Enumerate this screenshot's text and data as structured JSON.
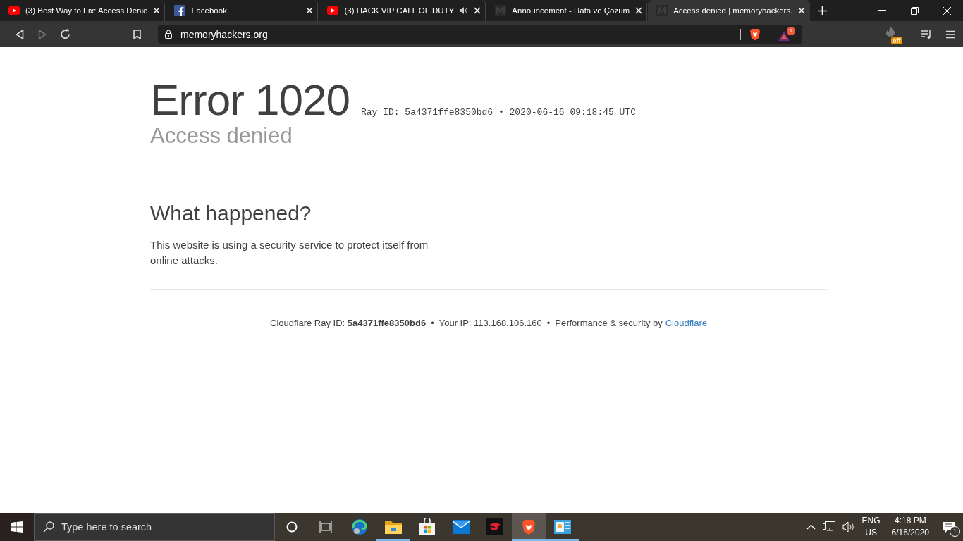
{
  "tabs": [
    {
      "title": "(3) Best Way to Fix: Access Denie",
      "kind": "youtube",
      "audio": false,
      "selected": false
    },
    {
      "title": "Facebook",
      "kind": "facebook",
      "audio": false,
      "selected": false
    },
    {
      "title": "(3) HACK VIP CALL OF DUTY",
      "kind": "youtube",
      "audio": true,
      "selected": false
    },
    {
      "title": "Announcement - Hata ve Çözüm",
      "kind": "m",
      "audio": false,
      "selected": false
    },
    {
      "title": "Access denied | memoryhackers.",
      "kind": "m",
      "audio": false,
      "selected": true
    }
  ],
  "toolbar": {
    "url": "memoryhackers.org",
    "rewards_badge": "1",
    "extension_badge": "off"
  },
  "page": {
    "title": "Error 1020",
    "ray_line": "Ray ID: 5a4371ffe8350bd6 • 2020-06-16 09:18:45 UTC",
    "subtitle": "Access denied",
    "heading": "What happened?",
    "paragraph": "This website is using a security service to protect itself from online attacks.",
    "footer": [
      {
        "kind": "text",
        "text": "Cloudflare Ray ID: **5a4371ffe8350bd6**"
      },
      {
        "kind": "sep",
        "text": "•"
      },
      {
        "kind": "text",
        "text": "Your IP: 113.168.106.160"
      },
      {
        "kind": "sep",
        "text": "•"
      },
      {
        "kind": "text",
        "text": "Performance & security by"
      },
      {
        "kind": "link",
        "text": "Cloudflare"
      }
    ]
  },
  "taskbar": {
    "search_placeholder": "Type here to search",
    "apps": [
      {
        "kind": "cortana",
        "running": false,
        "selected": false
      },
      {
        "kind": "taskview",
        "running": false,
        "selected": false
      },
      {
        "kind": "edge",
        "running": false,
        "selected": false
      },
      {
        "kind": "explorer",
        "running": true,
        "selected": false
      },
      {
        "kind": "store",
        "running": false,
        "selected": false
      },
      {
        "kind": "mail",
        "running": false,
        "selected": false
      },
      {
        "kind": "garena",
        "running": false,
        "selected": false
      },
      {
        "kind": "brave",
        "running": true,
        "selected": true
      },
      {
        "kind": "control",
        "running": true,
        "selected": false
      }
    ],
    "language": "ENG",
    "region": "US",
    "time": "4:18 PM",
    "date": "6/16/2020",
    "notifications": "1"
  }
}
